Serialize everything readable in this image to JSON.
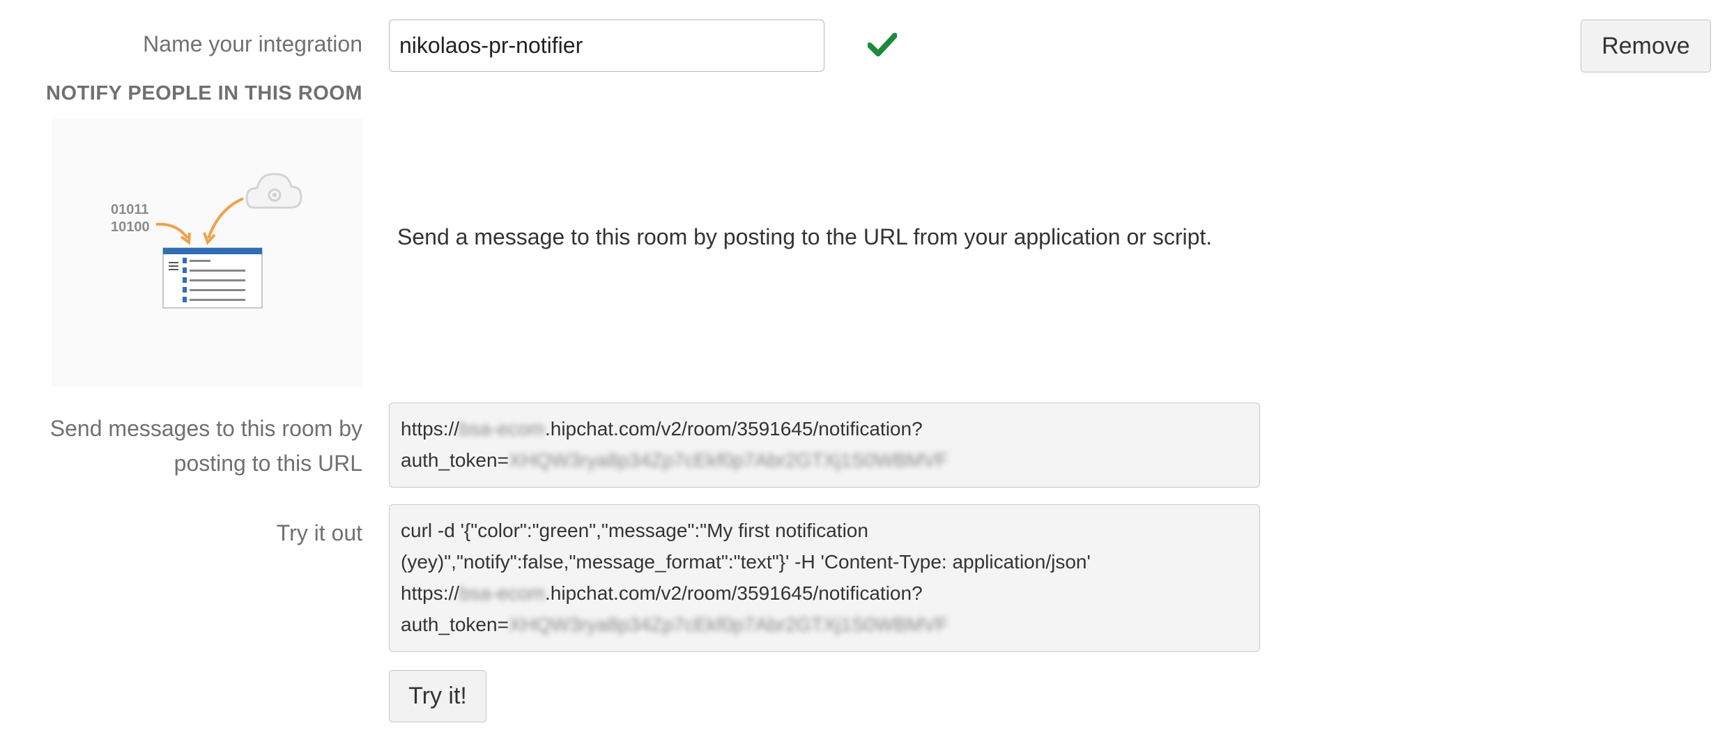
{
  "form": {
    "name_label": "Name your integration",
    "name_value": "nikolaos-pr-notifier",
    "remove_label": "Remove",
    "section_heading": "NOTIFY PEOPLE IN THIS ROOM",
    "illustration_binary_1": "01011",
    "illustration_binary_2": "10100",
    "description": "Send a message to this room by posting to the URL from your application or script.",
    "url_label_line1": "Send messages to this room by",
    "url_label_line2": "posting to this URL",
    "url": {
      "prefix": "https://",
      "redacted_subdomain": "bsa-ecom",
      "host_path": ".hipchat.com/v2/room/3591645/notification?",
      "token_prefix": "auth_token=",
      "redacted_token": "XHQW3rya8p34Zp7cEkf0p7Abr2GTXj1S0WBMVF"
    },
    "try_label": "Try it out",
    "curl": {
      "line1": "curl -d '{\"color\":\"green\",\"message\":\"My first notification",
      "line2": "(yey)\",\"notify\":false,\"message_format\":\"text\"}' -H 'Content-Type: application/json'",
      "line3_prefix": "https://",
      "line3_redacted": "bsa-ecom",
      "line3_rest": ".hipchat.com/v2/room/3591645/notification?",
      "line4_prefix": "auth_token=",
      "line4_redacted": "XHQW3rya8p34Zp7cEkf0p7Abr2GTXj1S0WBMVF"
    },
    "try_button_label": "Try it!"
  },
  "colors": {
    "check": "#1e8a3c",
    "arrow": "#f0a04b",
    "illustration_blue": "#2f6db5"
  },
  "icons": {
    "valid": "checkmark-icon",
    "illustration": "notification-api-illustration"
  }
}
